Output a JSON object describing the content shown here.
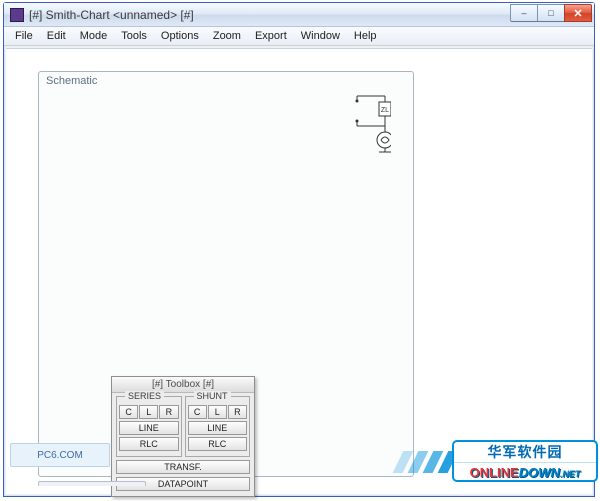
{
  "window": {
    "title": "[#] Smith-Chart <unnamed> [#]"
  },
  "menu": {
    "items": [
      "File",
      "Edit",
      "Mode",
      "Tools",
      "Options",
      "Zoom",
      "Export",
      "Window",
      "Help"
    ]
  },
  "schematic": {
    "title": "Schematic",
    "load_label": "Zₗ"
  },
  "toolbox": {
    "title": "[#] Toolbox [#]",
    "series_label": "SERIES",
    "shunt_label": "SHUNT",
    "c": "C",
    "l": "L",
    "r": "R",
    "line": "LINE",
    "rlc": "RLC",
    "transf": "TRANSF.",
    "datapoint": "DATAPOINT"
  },
  "watermark": {
    "left": "PC6.COM",
    "right_top": "华军软件园",
    "right_bottom_1": "ONLINE",
    "right_bottom_2": "DOWN",
    "right_bottom_3": ".NET"
  },
  "win_controls": {
    "min": "–",
    "max": "□",
    "close": "✕"
  }
}
